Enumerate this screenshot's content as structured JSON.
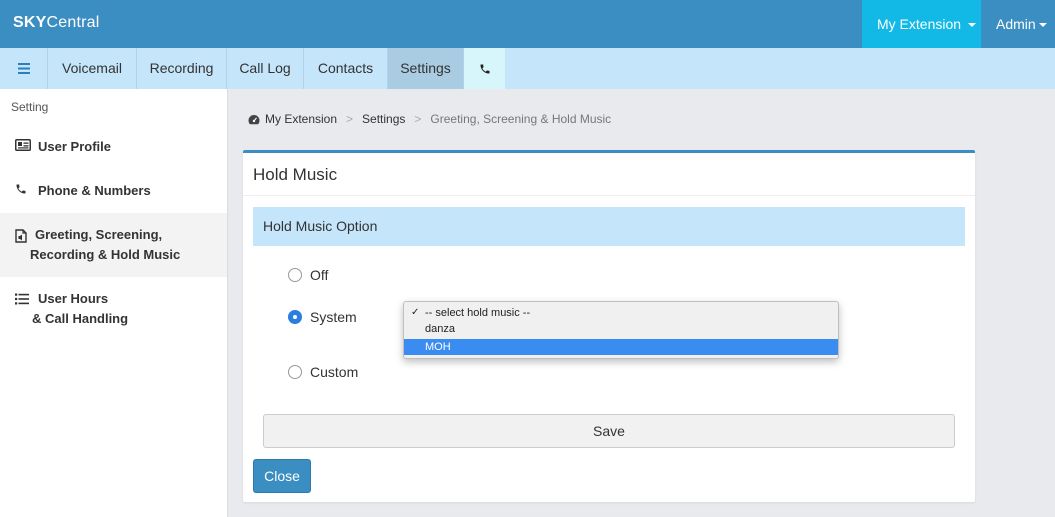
{
  "app": {
    "brand_bold": "SKY",
    "brand_rest": "Central"
  },
  "header": {
    "my_extension": "My Extension",
    "admin": "Admin"
  },
  "nav": {
    "tabs": [
      {
        "label": "Voicemail"
      },
      {
        "label": "Recording"
      },
      {
        "label": "Call Log"
      },
      {
        "label": "Contacts"
      },
      {
        "label": "Settings",
        "active": true
      }
    ]
  },
  "sidebar": {
    "heading": "Setting",
    "items": [
      {
        "label": "User Profile",
        "icon": "id-card-icon"
      },
      {
        "label": "Phone & Numbers",
        "icon": "phone-icon"
      },
      {
        "label_line1": "Greeting, Screening,",
        "label_line2": "Recording & Hold Music",
        "icon": "audio-file-icon",
        "active": true
      },
      {
        "label_line1": "User Hours",
        "label_line2": "& Call Handling",
        "icon": "list-icon"
      }
    ]
  },
  "breadcrumb": {
    "items": [
      "My Extension",
      "Settings",
      "Greeting, Screening & Hold Music"
    ],
    "separator": ">"
  },
  "panel": {
    "title": "Hold Music",
    "section": "Hold Music Option",
    "options": [
      {
        "label": "Off",
        "checked": false
      },
      {
        "label": "System",
        "checked": true
      },
      {
        "label": "Custom",
        "checked": false
      }
    ],
    "select": {
      "options": [
        "-- select hold music --",
        "danza",
        "MOH"
      ],
      "checked_index": 0,
      "highlighted_index": 2
    },
    "save_label": "Save",
    "close_label": "Close"
  },
  "colors": {
    "topbar": "#3b8ec2",
    "accent_cyan": "#12b8e6",
    "nav_bg": "#c5e5fb",
    "highlight": "#3a8cf0"
  }
}
